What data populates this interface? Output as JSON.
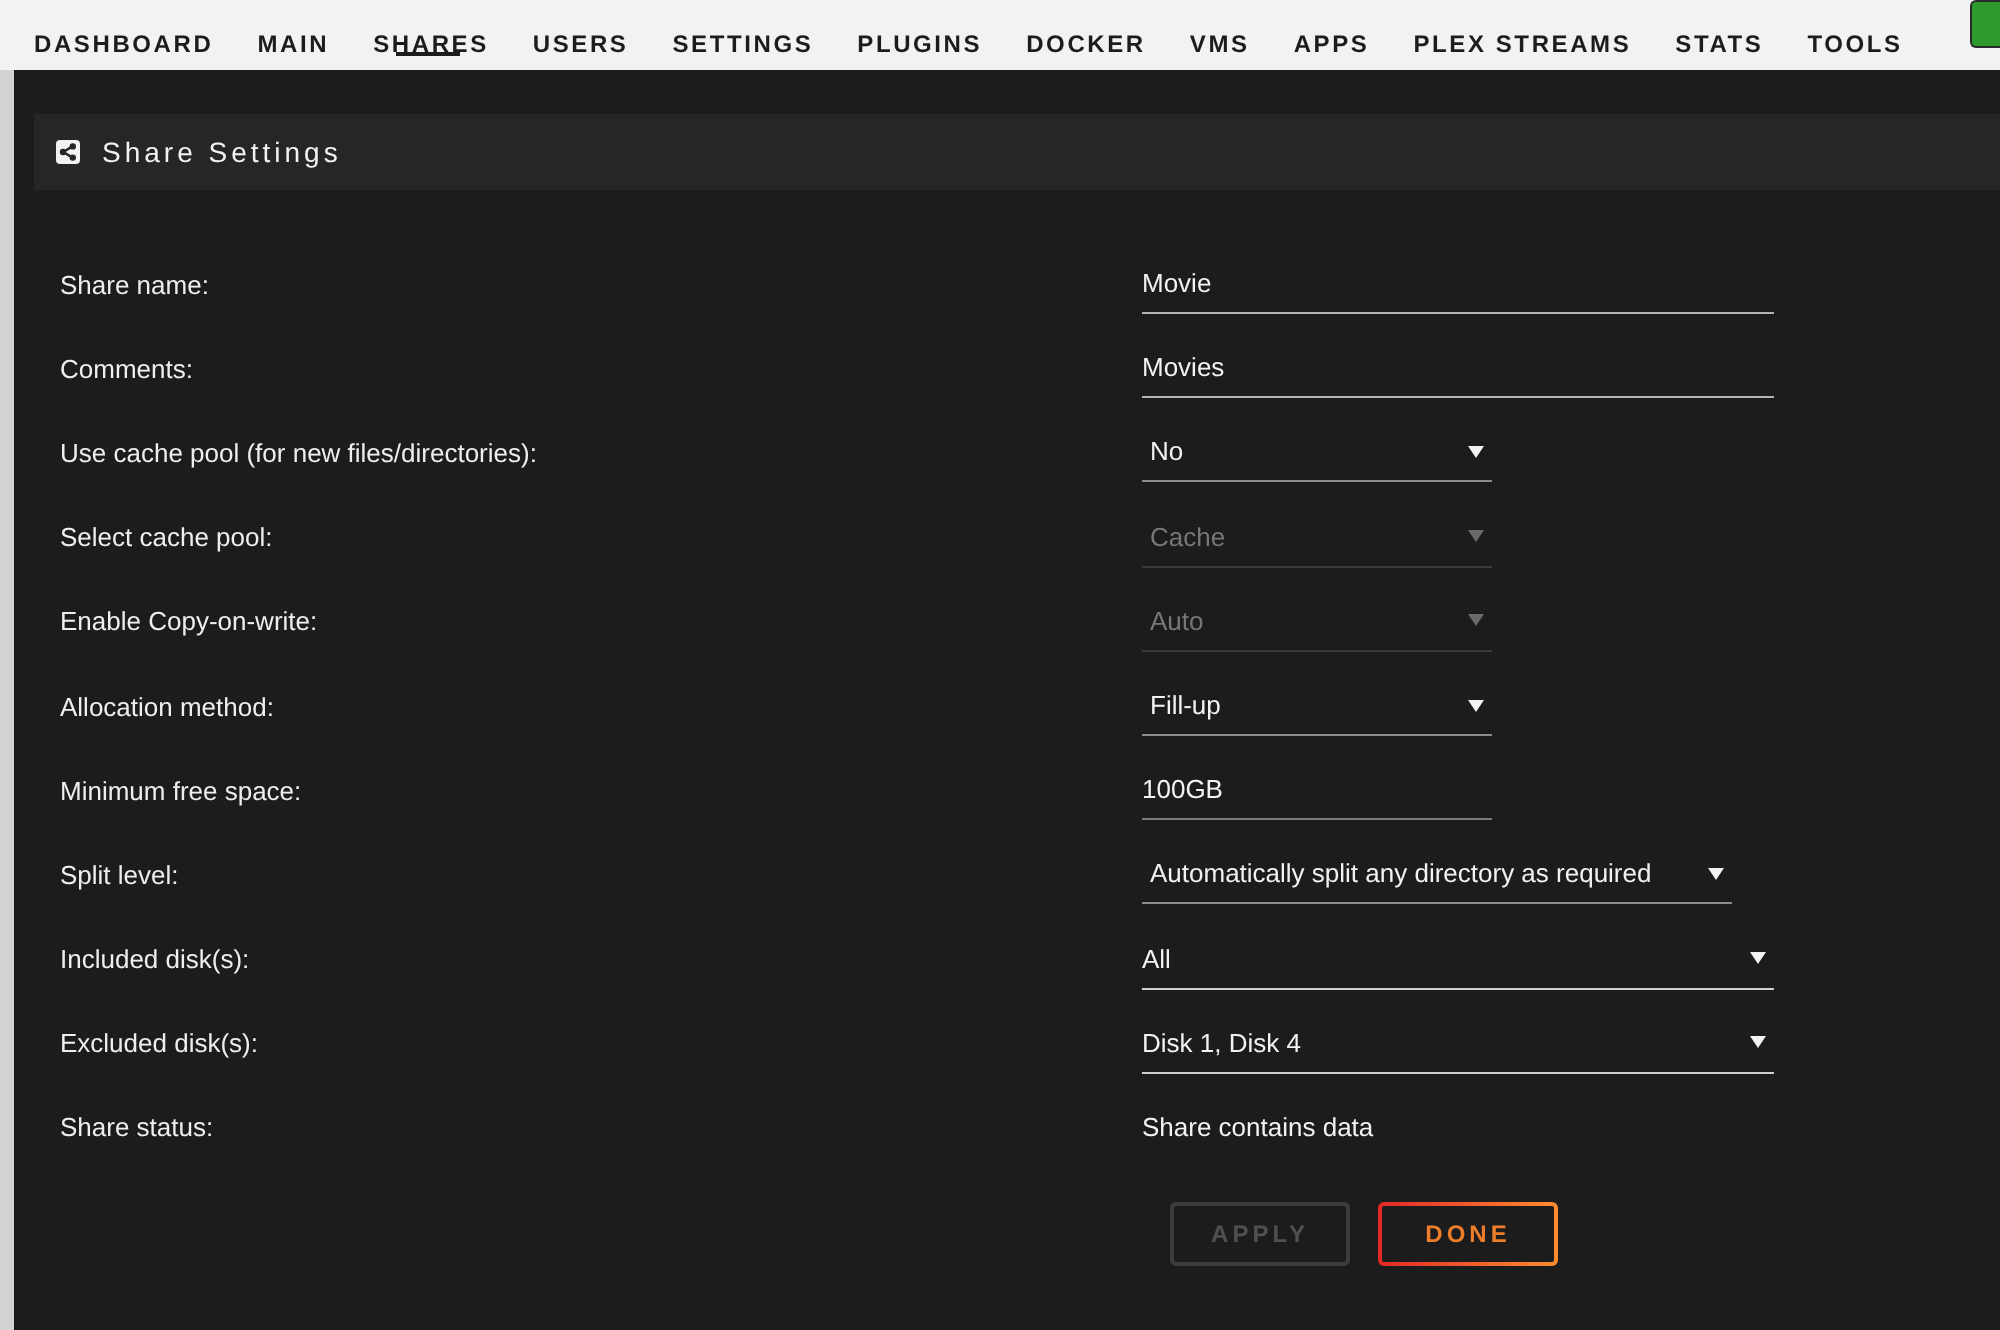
{
  "nav": {
    "items": [
      {
        "label": "DASHBOARD",
        "selected": false
      },
      {
        "label": "MAIN",
        "selected": false
      },
      {
        "label": "SHARES",
        "selected": true
      },
      {
        "label": "USERS",
        "selected": false
      },
      {
        "label": "SETTINGS",
        "selected": false
      },
      {
        "label": "PLUGINS",
        "selected": false
      },
      {
        "label": "DOCKER",
        "selected": false
      },
      {
        "label": "VMS",
        "selected": false
      },
      {
        "label": "APPS",
        "selected": false
      },
      {
        "label": "PLEX STREAMS",
        "selected": false
      },
      {
        "label": "STATS",
        "selected": false
      },
      {
        "label": "TOOLS",
        "selected": false
      }
    ]
  },
  "panel": {
    "title": "Share Settings",
    "fields": [
      {
        "label": "Share name:",
        "kind": "text",
        "value": "Movie",
        "disabled": false
      },
      {
        "label": "Comments:",
        "kind": "text",
        "value": "Movies",
        "disabled": false
      },
      {
        "label": "Use cache pool (for new files/directories):",
        "kind": "select",
        "value": "No",
        "disabled": false
      },
      {
        "label": "Select cache pool:",
        "kind": "select",
        "value": "Cache",
        "disabled": true
      },
      {
        "label": "Enable Copy-on-write:",
        "kind": "select",
        "value": "Auto",
        "disabled": true
      },
      {
        "label": "Allocation method:",
        "kind": "select",
        "value": "Fill-up",
        "disabled": false
      },
      {
        "label": "Minimum free space:",
        "kind": "quantity",
        "value": "100GB",
        "disabled": false
      },
      {
        "label": "Split level:",
        "kind": "select",
        "value": "Automatically split any directory as required",
        "disabled": false
      },
      {
        "label": "Included disk(s):",
        "kind": "multiselect",
        "value": "All",
        "disabled": false
      },
      {
        "label": "Excluded disk(s):",
        "kind": "multiselect",
        "value": "Disk 1, Disk 4",
        "disabled": false
      },
      {
        "label": "Share status:",
        "kind": "status",
        "value": "Share contains data",
        "disabled": false
      }
    ],
    "buttons": [
      {
        "label": "APPLY",
        "disabled": true
      },
      {
        "label": "DONE",
        "disabled": false
      }
    ]
  }
}
